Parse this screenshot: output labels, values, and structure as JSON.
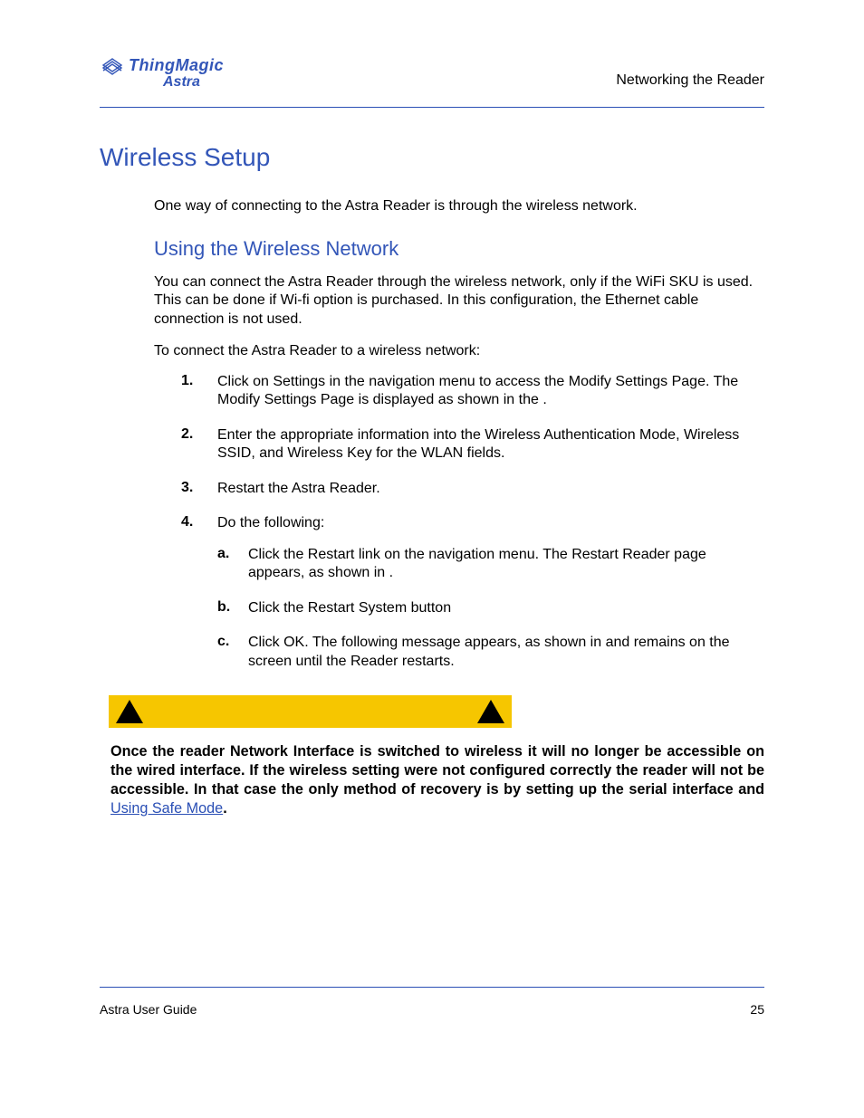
{
  "header": {
    "logo_main": "ThingMagic",
    "logo_sub": "Astra",
    "section_label": "Networking the Reader"
  },
  "title": "Wireless Setup",
  "intro": "One way of connecting to the Astra Reader is through the wireless network.",
  "subtitle": "Using the Wireless Network",
  "para1": "You can connect the Astra Reader through the wireless network, only if the WiFi SKU is used. This can be done if Wi-fi option is purchased. In this configuration, the Ethernet cable connection is not used.",
  "para2": "To connect the Astra Reader to a wireless network:",
  "steps": [
    {
      "num": "1.",
      "text": "Click on Settings in the navigation menu to access the Modify Settings Page. The Modify Settings Page is displayed as shown in the ."
    },
    {
      "num": "2.",
      "text": "Enter the appropriate information into the Wireless Authentication Mode, Wireless SSID, and Wireless Key for the WLAN fields."
    },
    {
      "num": "3.",
      "text": "Restart the Astra Reader."
    },
    {
      "num": "4.",
      "text": "Do the following:",
      "sub": [
        {
          "letter": "a.",
          "text": "Click the Restart link on the navigation menu. The Restart Reader page appears, as shown in ."
        },
        {
          "letter": "b.",
          "text": "Click the Restart System button"
        },
        {
          "letter": "c.",
          "text": "Click OK. The following message appears, as shown in and remains on the screen until the Reader restarts."
        }
      ]
    }
  ],
  "warning": {
    "body_before_link": "Once the reader Network Interface is switched to wireless it will no longer be accessible on the wired interface. If the wireless setting were not configured correctly the reader will not be accessible. In that case the only method of recovery is by setting up the serial interface and ",
    "link_text": "Using Safe Mode",
    "body_after_link": "."
  },
  "footer": {
    "left": "Astra User Guide",
    "right": "25"
  }
}
